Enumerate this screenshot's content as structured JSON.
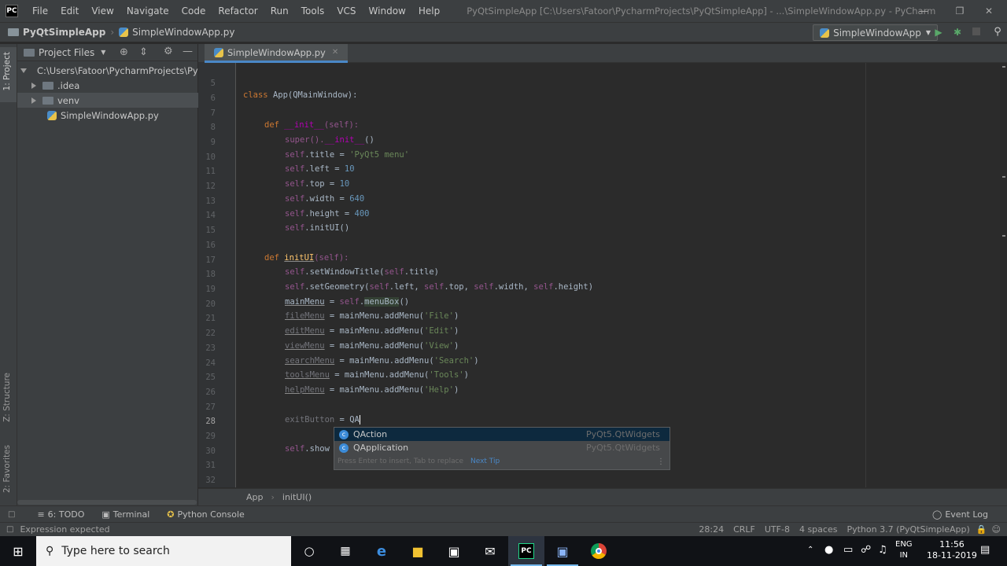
{
  "titlebar": {
    "app_icon": "PC",
    "menus": [
      "File",
      "Edit",
      "View",
      "Navigate",
      "Code",
      "Refactor",
      "Run",
      "Tools",
      "VCS",
      "Window",
      "Help"
    ],
    "window_title": "PyQtSimpleApp [C:\\Users\\Fatoor\\PycharmProjects\\PyQtSimpleApp] - ...\\SimpleWindowApp.py - PyCharm"
  },
  "navbar": {
    "project": "PyQtSimpleApp",
    "file": "SimpleWindowApp.py",
    "run_config": "SimpleWindowApp"
  },
  "left_strip": {
    "project_tab": "1: Project",
    "structure_tab": "Z: Structure",
    "favorites_tab": "2: Favorites"
  },
  "project_panel": {
    "view_mode": "Project Files",
    "items": [
      {
        "label": "C:\\Users\\Fatoor\\PycharmProjects\\PyQtSimpleApp",
        "type": "folder",
        "expanded": true
      },
      {
        "label": ".idea",
        "type": "folder",
        "expanded": false
      },
      {
        "label": "venv",
        "type": "folder",
        "expanded": false
      },
      {
        "label": "SimpleWindowApp.py",
        "type": "python-file"
      }
    ]
  },
  "editor": {
    "tab_label": "SimpleWindowApp.py",
    "line_numbers": [
      "5",
      "6",
      "7",
      "8",
      "9",
      "10",
      "11",
      "12",
      "13",
      "14",
      "15",
      "16",
      "17",
      "18",
      "19",
      "20",
      "21",
      "22",
      "23",
      "24",
      "25",
      "26",
      "27",
      "28",
      "29",
      "30",
      "31",
      "32"
    ],
    "code": {
      "class_kw": "class ",
      "class_name": "App",
      "class_base": "(QMainWindow):",
      "def_kw": "def ",
      "init_name": "__init__",
      "self_param": "(self):",
      "super_call": "super().",
      "init_call": "__init__",
      "call_paren": "()",
      "self": "self",
      "title_attr": ".title = ",
      "title_val": "'PyQt5 menu'",
      "left_attr": ".left = ",
      "left_val": "10",
      "top_attr": ".top = ",
      "top_val": "10",
      "width_attr": ".width = ",
      "width_val": "640",
      "height_attr": ".height = ",
      "height_val": "400",
      "initui_call": ".initUI()",
      "initui_name": "initUI",
      "setwindow": ".setWindowTitle(",
      "title_ref": ".title)",
      "setgeo": ".setGeometry(",
      "geo_left": ".left, ",
      "geo_top": ".top, ",
      "geo_width": ".width, ",
      "geo_height": ".height)",
      "mainmenu": "mainMenu",
      "assign": " = ",
      "menubox": "menuBox",
      "paren": "()",
      "filemenu": "fileMenu",
      "editmenu": "editMenu",
      "viewmenu": "viewMenu",
      "searchmenu": "searchMenu",
      "toolsmenu": "toolsMenu",
      "helpmenu": "helpMenu",
      "addmenu": " = mainMenu.addMenu(",
      "close": ")",
      "str_file": "'File'",
      "str_edit": "'Edit'",
      "str_view": "'View'",
      "str_search": "'Search'",
      "str_tools": "'Tools'",
      "str_help": "'Help'",
      "exitbutton": "exitButton",
      "typed": "QA",
      "show_partial": ".show"
    }
  },
  "completion": {
    "items": [
      {
        "name": "QAction",
        "module": "PyQt5.QtWidgets"
      },
      {
        "name": "QApplication",
        "module": "PyQt5.QtWidgets"
      }
    ],
    "hint": "Press Enter to insert, Tab to replace",
    "hint_link": "Next Tip"
  },
  "breadcrumbs": [
    "App",
    "initUI()"
  ],
  "toolwindows": {
    "todo": "6: TODO",
    "terminal": "Terminal",
    "console": "Python Console",
    "event_log": "Event Log"
  },
  "status": {
    "message": "Expression expected",
    "position": "28:24",
    "line_sep": "CRLF",
    "encoding": "UTF-8",
    "indent": "4 spaces",
    "interpreter": "Python 3.7 (PyQtSimpleApp)"
  },
  "taskbar": {
    "search_placeholder": "Type here to search",
    "lang": "ENG",
    "region": "IN",
    "time": "11:56",
    "date": "18-11-2019"
  },
  "colors": {
    "accent": "#4a88c7",
    "editor_bg": "#2b2b2b",
    "panel_bg": "#3c3f41",
    "keyword": "#cc7832",
    "string": "#6a8759"
  }
}
